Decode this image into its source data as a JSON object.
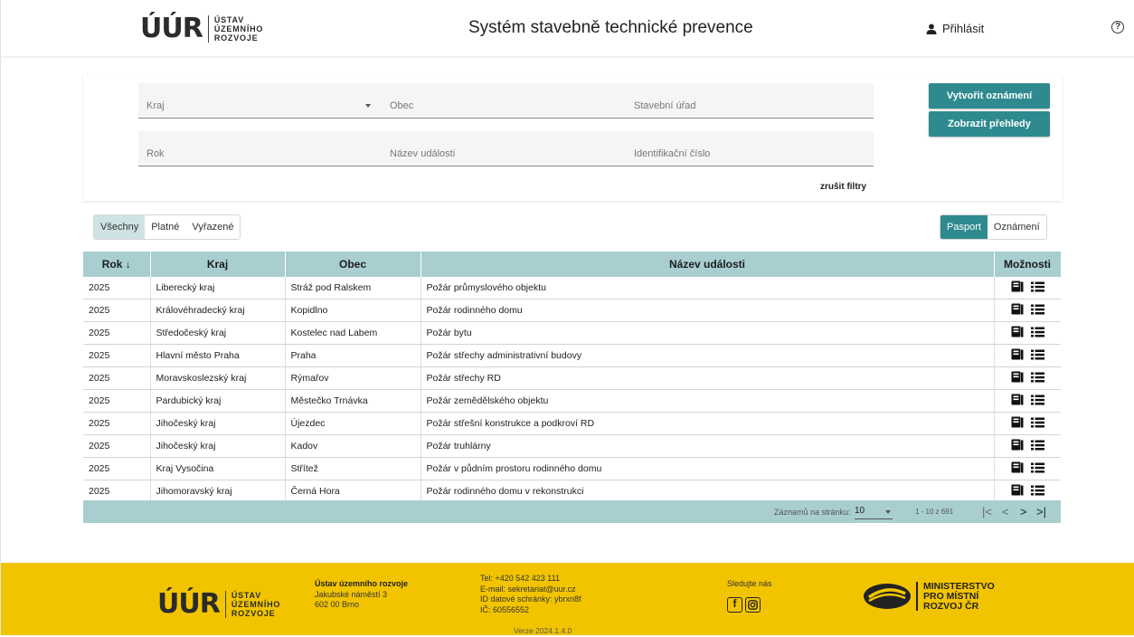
{
  "header": {
    "logo_mark": "ÚÚR",
    "logo_lines": [
      "ÚSTAV",
      "ÚZEMNÍHO",
      "ROZVOJE"
    ],
    "title": "Systém stavebně technické prevence",
    "login": "Přihlásit",
    "help_icon": "?"
  },
  "filters": {
    "kraj": "Kraj",
    "obec": "Obec",
    "stavebni_urad": "Stavební úřad",
    "rok": "Rok",
    "nazev_udalosti": "Název události",
    "identifikacni_cislo": "Identifikační číslo",
    "clear": "zrušit filtry"
  },
  "actions": {
    "create": "Vytvořit oznámení",
    "show": "Zobrazit přehledy"
  },
  "status_tabs": [
    "Všechny",
    "Platné",
    "Vyřazené"
  ],
  "view_tabs": [
    "Pasport",
    "Oznámení"
  ],
  "table": {
    "headers": [
      "Rok ↓",
      "Kraj",
      "Obec",
      "Název události",
      "Možnosti"
    ],
    "rows": [
      [
        "2025",
        "Liberecký kraj",
        "Stráž pod Ralskem",
        "Požár průmyslového objektu"
      ],
      [
        "2025",
        "Královéhradecký kraj",
        "Kopidlno",
        "Požár rodinného domu"
      ],
      [
        "2025",
        "Středočeský kraj",
        "Kostelec nad Labem",
        "Požár bytu"
      ],
      [
        "2025",
        "Hlavní město Praha",
        "Praha",
        "Požár střechy administrativní budovy"
      ],
      [
        "2025",
        "Moravskoslezský kraj",
        "Rýmařov",
        "Požár střechy RD"
      ],
      [
        "2025",
        "Pardubický kraj",
        "Městečko Trnávka",
        "Požár zemědělského objektu"
      ],
      [
        "2025",
        "Jihočeský kraj",
        "Újezdec",
        "Požár střešní konstrukce a podkroví RD"
      ],
      [
        "2025",
        "Jihočeský kraj",
        "Kadov",
        "Požár truhlárny"
      ],
      [
        "2025",
        "Kraj Vysočina",
        "Střítež",
        "Požár v půdním prostoru rodinného domu"
      ],
      [
        "2025",
        "Jihomoravský kraj",
        "Černá Hora",
        "Požár rodinného domu v rekonstrukci"
      ]
    ]
  },
  "pagination": {
    "per_page_label": "Záznamů na stránku:",
    "per_page": "10",
    "range": "1 - 10 z 691",
    "first": "|<",
    "prev": "<",
    "next": ">",
    "last": ">|"
  },
  "footer": {
    "org_name": "Ústav územního rozvoje",
    "address1": "Jakubské náměstí 3",
    "address2": "602 00 Brno",
    "tel": "Tel: +420 542 423 111",
    "email": "E-mail: sekretariat@uur.cz",
    "datova": "ID datové schránky: ybrxn8f",
    "ic": "IČ: 60556552",
    "version": "Verze 2024.1.4.0",
    "follow": "Sledujte nás",
    "facebook": "f",
    "ministry_lines": [
      "MINISTERSTVO",
      "PRO MÍSTNÍ",
      "ROZVOJ ČR"
    ]
  },
  "colors": {
    "accent": "#2e8a8f",
    "table_header": "#a8ced0",
    "footer": "#f2c400"
  }
}
